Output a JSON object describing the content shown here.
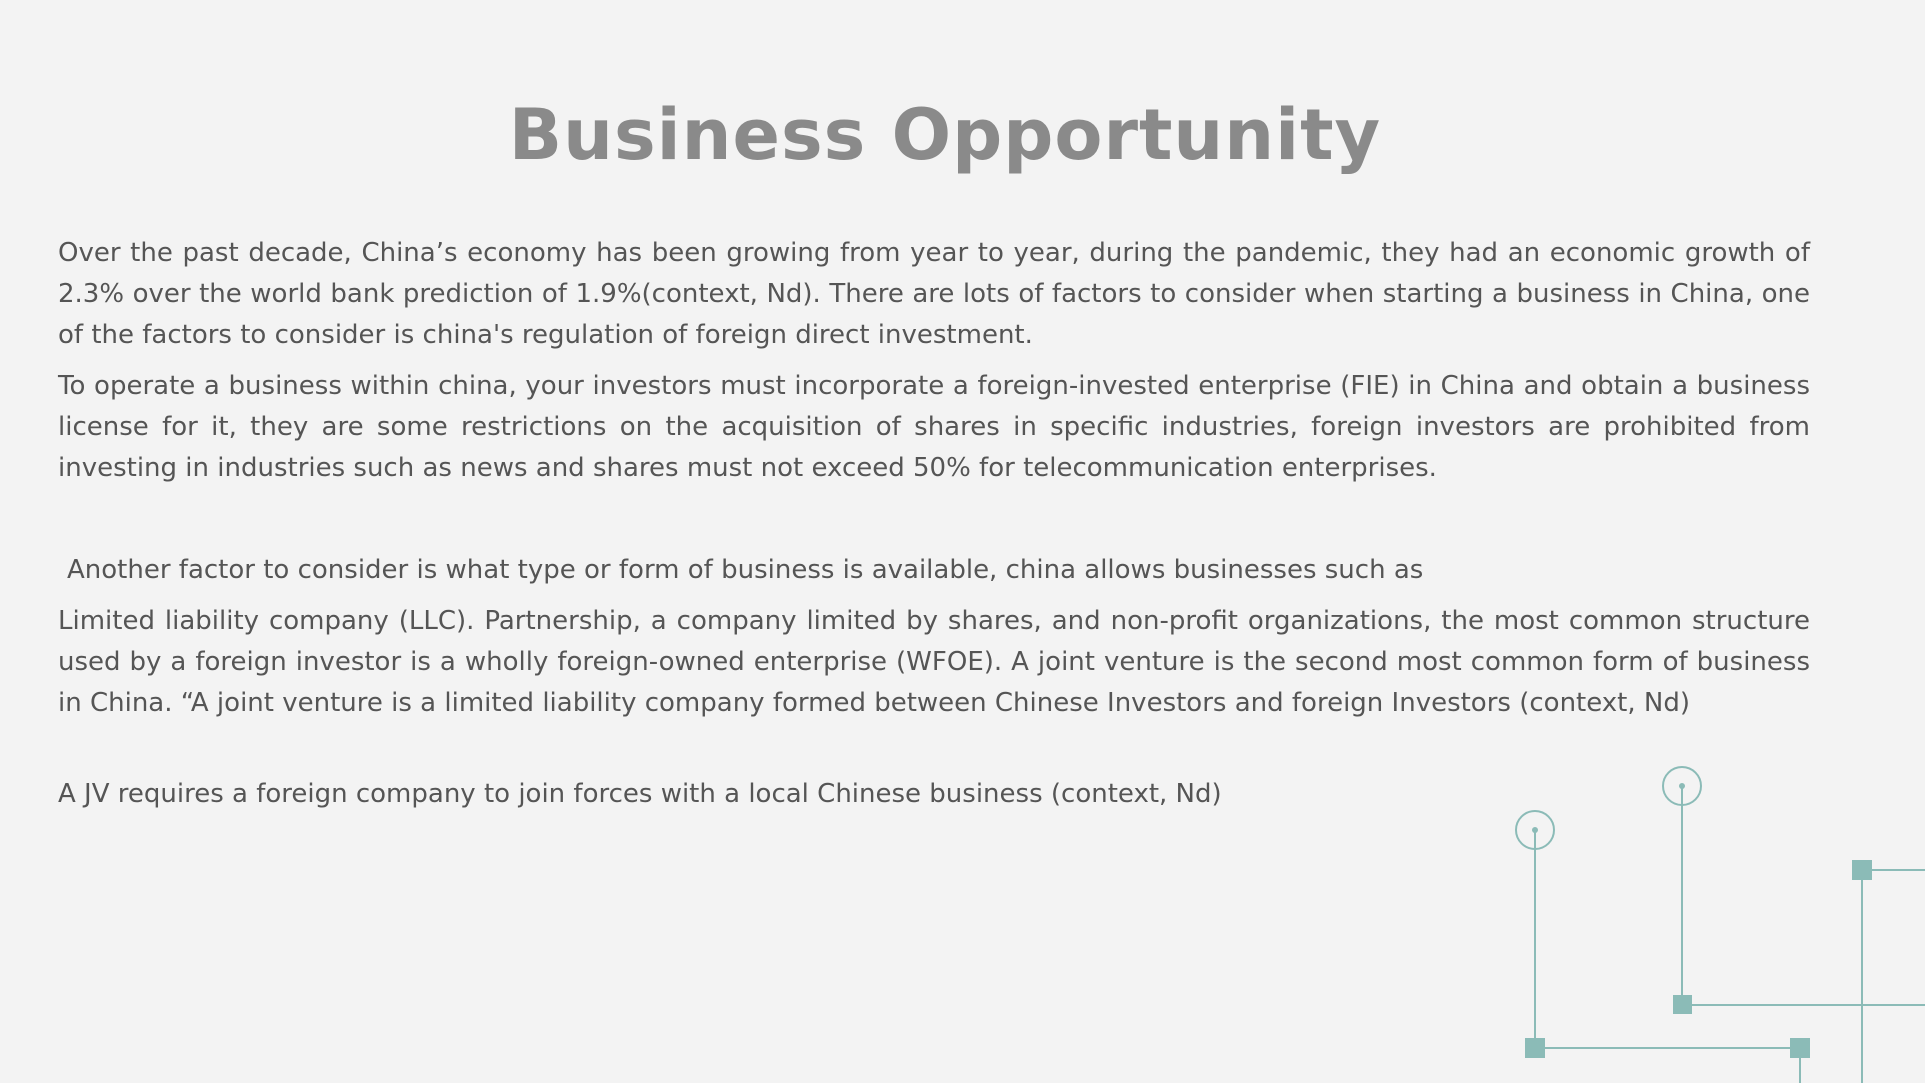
{
  "slide": {
    "title": "Business Opportunity",
    "paragraphs": {
      "p1": "Over the past decade, China’s economy has been growing from year to year, during the pandemic, they had an economic growth of 2.3% over the world bank prediction of 1.9%(context, Nd). There are lots of factors to consider when starting a business in China, one of the factors to consider is china's regulation of foreign direct investment.",
      "p2": "To operate a business within china, your investors must incorporate a foreign-invested enterprise (FIE) in China and obtain a business license for it, they are some restrictions on the acquisition of shares in specific industries, foreign investors are prohibited from investing in industries such as news and shares must not exceed 50% for telecommunication enterprises.",
      "p3": "Another factor to consider is what type or form of business is available, china allows businesses such as",
      "p4": "Limited liability company (LLC). Partnership, a company limited by shares, and non-profit organizations, the most common structure used by a foreign investor is a wholly foreign-owned enterprise (WFOE). A joint venture is the second most common form of business in China. “A joint venture is a limited liability company formed between Chinese Investors and foreign Investors (context, Nd)",
      "p5": "A JV requires a foreign company to join forces with a local Chinese business (context, Nd)"
    },
    "colors": {
      "background": "#f3f3f3",
      "title": "#8a8a8a",
      "text": "#555555",
      "accent": "#8bbbb7"
    }
  }
}
